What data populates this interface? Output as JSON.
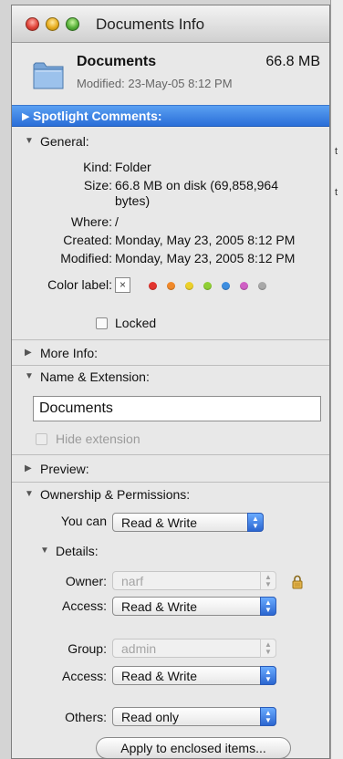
{
  "window": {
    "title": "Documents Info"
  },
  "header": {
    "name": "Documents",
    "size": "66.8 MB",
    "modified": "Modified: 23-May-05 8:12 PM"
  },
  "sections": {
    "spotlight": "Spotlight Comments:",
    "general": "General:",
    "more_info": "More Info:",
    "name_extension": "Name & Extension:",
    "preview": "Preview:",
    "ownership": "Ownership & Permissions:"
  },
  "general": {
    "kind_label": "Kind:",
    "kind_value": "Folder",
    "size_label": "Size:",
    "size_value_line1": "66.8 MB on disk (69,858,964",
    "size_value_line2": "bytes)",
    "where_label": "Where:",
    "where_value": "/",
    "created_label": "Created:",
    "created_value": "Monday, May 23, 2005 8:12 PM",
    "modified_label": "Modified:",
    "modified_value": "Monday, May 23, 2005 8:12 PM",
    "color_label": "Color label:",
    "color_none_glyph": "×",
    "colors": [
      "#e2342e",
      "#f0892a",
      "#ecd02a",
      "#8fcf34",
      "#3d8ee0",
      "#cf5fc4",
      "#a8a8a8"
    ],
    "locked_label": "Locked"
  },
  "name_extension": {
    "name_value": "Documents",
    "hide_extension_label": "Hide extension"
  },
  "ownership": {
    "you_can_label": "You can",
    "you_can_value": "Read & Write",
    "details_label": "Details:",
    "owner_label": "Owner:",
    "owner_value": "narf",
    "owner_access_label": "Access:",
    "owner_access_value": "Read & Write",
    "group_label": "Group:",
    "group_value": "admin",
    "group_access_label": "Access:",
    "group_access_value": "Read & Write",
    "others_label": "Others:",
    "others_value": "Read only",
    "apply_button": "Apply to enclosed items..."
  },
  "background_fragments": {
    "frag1": "t",
    "frag2": "t"
  }
}
